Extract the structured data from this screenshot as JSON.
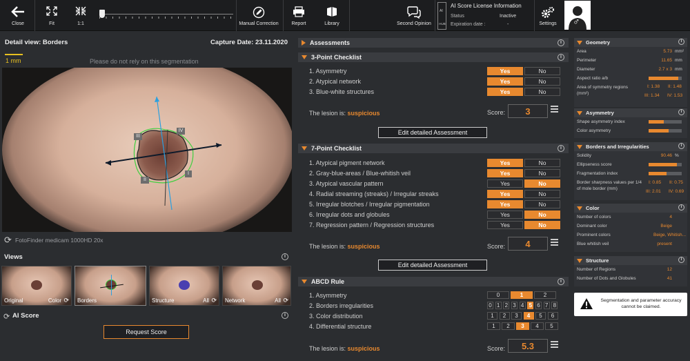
{
  "toolbar": {
    "close": "Close",
    "fit": "Fit",
    "one_to_one": "1:1",
    "manual_correction": "Manual Correction",
    "report": "Report",
    "library": "Library",
    "second_opinion": "Second Opinion",
    "settings": "Settings",
    "license": {
      "ai_label": "AI",
      "hub_label": "HUB",
      "title": "AI Score License Information",
      "status_label": "Status",
      "status_value": "Inactive",
      "expiration_label": "Expiration date :",
      "expiration_value": "-"
    }
  },
  "detail": {
    "title": "Detail view: Borders",
    "capture": "Capture Date: 23.11.2020",
    "scale": "1 mm",
    "warning": "Please do not rely on this segmentation",
    "quadrants": [
      "III",
      "IV",
      "II",
      "I"
    ],
    "camera": "FotoFinder medicam 1000HD 20x"
  },
  "views": {
    "title": "Views",
    "items": [
      {
        "label": "Original",
        "right": "Color"
      },
      {
        "label": "Borders",
        "right": ""
      },
      {
        "label": "Structure",
        "right": "All"
      },
      {
        "label": "Network",
        "right": "All"
      }
    ]
  },
  "ai_score": {
    "title": "AI Score",
    "button": "Request Score"
  },
  "assessments": {
    "title": "Assessments"
  },
  "checklist3": {
    "title": "3-Point Checklist",
    "items": [
      "1. Asymmetry",
      "2. Atypical network",
      "3. Blue-white structures"
    ],
    "answers": [
      "yes",
      "yes",
      "yes"
    ],
    "yes": "Yes",
    "no": "No",
    "result_label": "The lesion is:",
    "result": "suspicious",
    "score_label": "Score:",
    "score": "3",
    "edit": "Edit detailed Assessment"
  },
  "checklist7": {
    "title": "7-Point Checklist",
    "items": [
      "1. Atypical pigment network",
      "2. Gray-blue-areas / Blue-whitish veil",
      "3. Atypical vascular pattern",
      "4. Radial streaming (streaks) / Irregular streaks",
      "5. Irregular blotches / Irregular pigmentation",
      "6. Irregular dots and globules",
      "7. Regression pattern / Regression structures"
    ],
    "answers": [
      "yes",
      "yes",
      "no",
      "yes",
      "yes",
      "no",
      "no"
    ],
    "yes": "Yes",
    "no": "No",
    "result_label": "The lesion is:",
    "result": "suspicious",
    "score_label": "Score:",
    "score": "4",
    "edit": "Edit detailed Assessment"
  },
  "abcd": {
    "title": "ABCD Rule",
    "items": [
      "1. Asymmetry",
      "2. Borders irregularities",
      "3. Color distribution",
      "4. Differential structure"
    ],
    "scales": [
      [
        0,
        1,
        2
      ],
      [
        0,
        1,
        2,
        3,
        4,
        5,
        6,
        7,
        8
      ],
      [
        1,
        2,
        3,
        4,
        5,
        6
      ],
      [
        1,
        2,
        3,
        4,
        5
      ]
    ],
    "selected": [
      1,
      5,
      4,
      3
    ],
    "result_label": "The lesion is:",
    "result": "suspicious",
    "score_label": "Score:",
    "score": "5.3"
  },
  "geometry": {
    "title": "Geometry",
    "rows": [
      {
        "label": "Area",
        "value": "5.73",
        "unit": "mm²"
      },
      {
        "label": "Perimeter",
        "value": "11.65",
        "unit": "mm"
      },
      {
        "label": "Diameter",
        "value": "2.7 x 3",
        "unit": "mm"
      },
      {
        "label": "Aspect ratio a/b",
        "bar": 0.9
      },
      {
        "label": "Area of symmetry regions (mm²)",
        "v1": "I: 1.38",
        "v2": "II: 1.48",
        "v3": "III: 1.34",
        "v4": "IV: 1.53"
      }
    ]
  },
  "asymmetry": {
    "title": "Asymmetry",
    "rows": [
      {
        "label": "Shape asymmetry index",
        "bar": 0.45
      },
      {
        "label": "Color asymmetry",
        "bar": 0.6
      }
    ]
  },
  "borders": {
    "title": "Borders and Irregularities",
    "rows": [
      {
        "label": "Solidity",
        "value": "90.46",
        "unit": "%"
      },
      {
        "label": "Ellipseness score",
        "bar": 0.85
      },
      {
        "label": "Fragmentation index",
        "bar": 0.55
      },
      {
        "label": "Border sharpness values per 1/4 of mole border (mm)",
        "v1": "I: 0.85",
        "v2": "II: 0.75",
        "v3": "III: 2.01",
        "v4": "IV: 0.69"
      }
    ]
  },
  "color": {
    "title": "Color",
    "rows": [
      {
        "label": "Number of colors",
        "value": "4"
      },
      {
        "label": "Dominant color",
        "value": "Beige"
      },
      {
        "label": "Prominent colors",
        "value": "Beige, Whitish..."
      },
      {
        "label": "Blue whitish veil",
        "value": "present"
      }
    ]
  },
  "structure": {
    "title": "Structure",
    "rows": [
      {
        "label": "Number of Regions",
        "value": "12"
      },
      {
        "label": "Number of Dots and Globules",
        "value": "41"
      }
    ]
  },
  "notice": "Segmentation and parameter accuracy cannot be claimed.",
  "colors": {
    "accent": "#e8892f",
    "background": "#2b2d30"
  }
}
